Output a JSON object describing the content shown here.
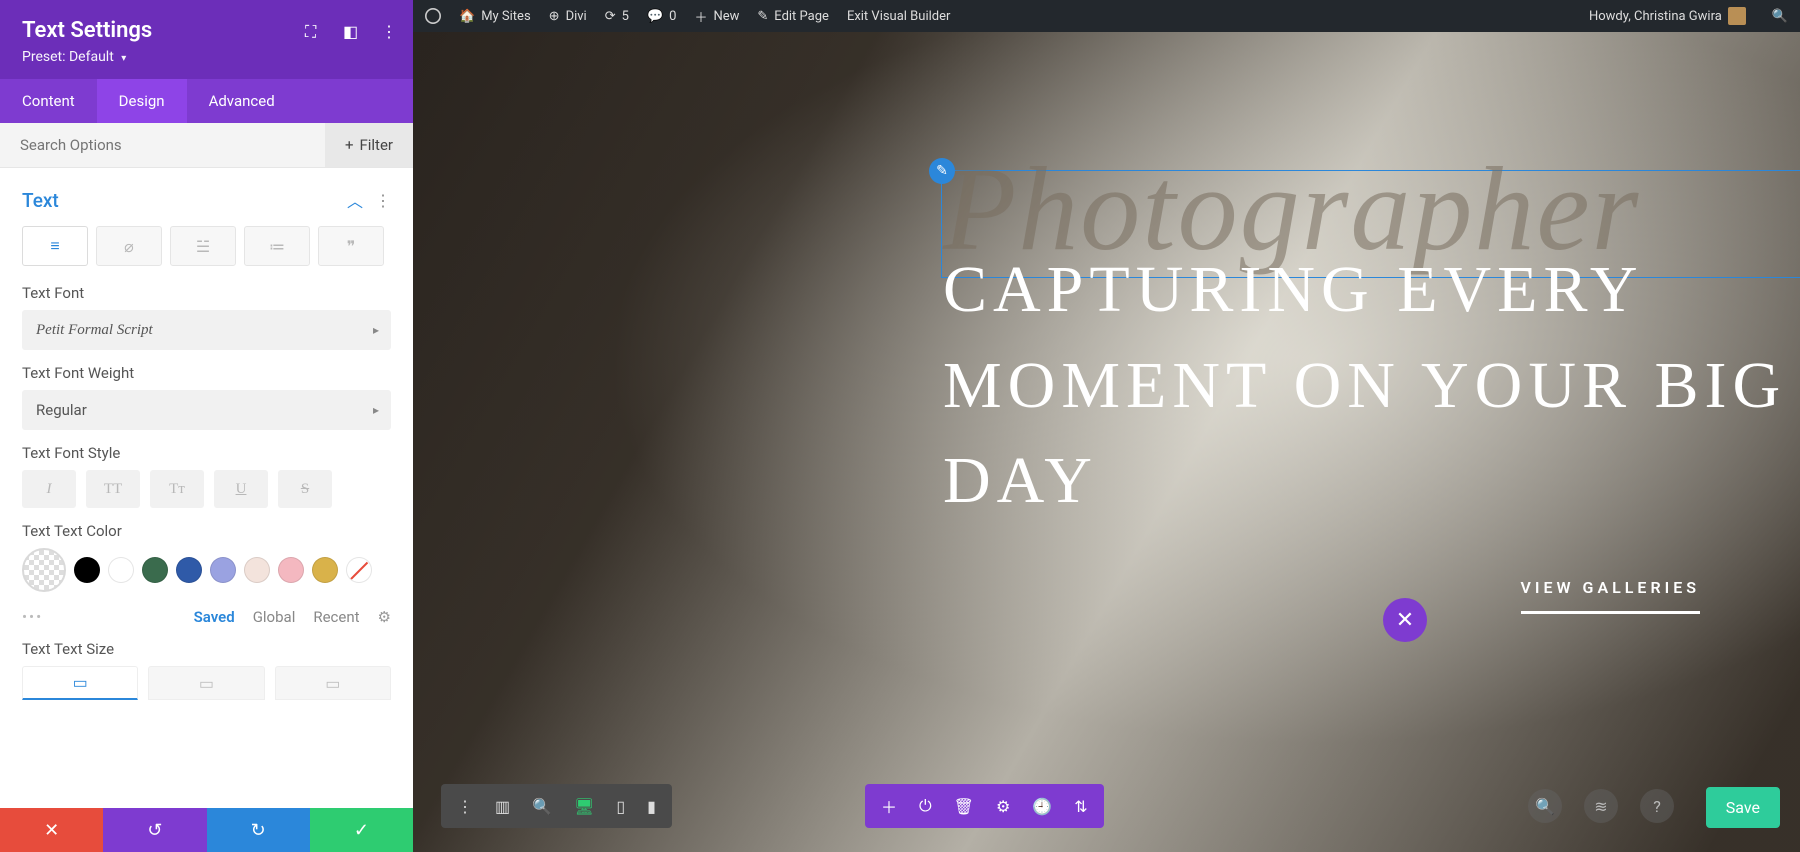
{
  "panel": {
    "title": "Text Settings",
    "preset_label": "Preset:",
    "preset_value": "Default",
    "tabs": {
      "content": "Content",
      "design": "Design",
      "advanced": "Advanced"
    },
    "search_placeholder": "Search Options",
    "filter_label": "Filter",
    "section_title": "Text",
    "labels": {
      "font": "Text Font",
      "weight": "Text Font Weight",
      "style": "Text Font Style",
      "color": "Text Text Color",
      "size": "Text Text Size"
    },
    "font_value": "Petit Formal Script",
    "weight_value": "Regular",
    "style_buttons": {
      "italic": "I",
      "uppercase": "TT",
      "smallcaps": "Tᴛ",
      "underline": "U",
      "strike": "S"
    },
    "color_swatches": [
      "#000000",
      "#ffffff",
      "#3a6b4d",
      "#2f5aa8",
      "#9aa2e1",
      "#f3e3dc",
      "#f4b8c0",
      "#d9b24a"
    ],
    "option_row": {
      "saved": "Saved",
      "global": "Global",
      "recent": "Recent"
    }
  },
  "adminbar": {
    "mysites": "My Sites",
    "sitename": "Divi",
    "updates": "5",
    "comments": "0",
    "new": "New",
    "edit": "Edit Page",
    "exit": "Exit Visual Builder",
    "greeting": "Howdy, Christina Gwira"
  },
  "hero": {
    "script": "Photographer",
    "heading": "CAPTURING EVERY MOMENT ON YOUR BIG DAY",
    "view_link": "VIEW GALLERIES"
  },
  "save_label": "Save"
}
